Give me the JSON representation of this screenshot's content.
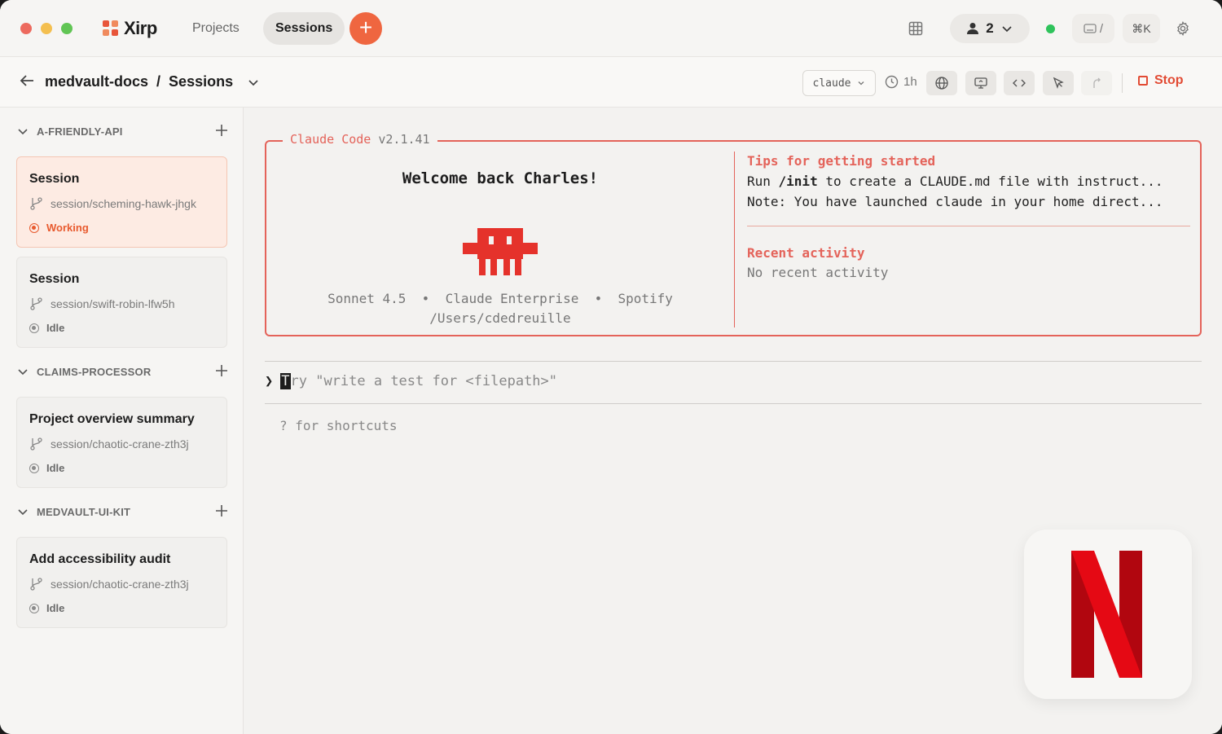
{
  "app": {
    "brand": "Xirp"
  },
  "topbar": {
    "nav_projects": "Projects",
    "nav_sessions": "Sessions",
    "add_label": "+",
    "users_count": "2",
    "kbd_shortcut": "/",
    "cmd_shortcut": "⌘K",
    "status_color": "#2fc35b"
  },
  "subheader": {
    "project": "medvault-docs",
    "separator": "/",
    "section": "Sessions",
    "model": "claude",
    "duration": "1h",
    "stop_label": "Stop"
  },
  "sidebar": {
    "groups": [
      {
        "name": "A-FRIENDLY-API",
        "sessions": [
          {
            "title": "Session",
            "branch": "session/scheming-hawk-jhgk",
            "status": "Working",
            "active": true
          },
          {
            "title": "Session",
            "branch": "session/swift-robin-lfw5h",
            "status": "Idle",
            "active": false
          }
        ]
      },
      {
        "name": "CLAIMS-PROCESSOR",
        "sessions": [
          {
            "title": "Project overview summary",
            "branch": "session/chaotic-crane-zth3j",
            "status": "Idle",
            "active": false
          }
        ]
      },
      {
        "name": "MEDVAULT-UI-KIT",
        "sessions": [
          {
            "title": "Add accessibility audit",
            "branch": "session/chaotic-crane-zth3j",
            "status": "Idle",
            "active": false
          }
        ]
      }
    ]
  },
  "terminal": {
    "legend_name": "Claude Code",
    "legend_version": "v2.1.41",
    "welcome": "Welcome back Charles!",
    "meta": "Sonnet 4.5  •  Claude Enterprise  •  Spotify",
    "path": "/Users/cdedreuille",
    "tips_title": "Tips for getting started",
    "tip1_pre": "Run ",
    "tip1_cmd": "/init",
    "tip1_post": " to create a CLAUDE.md file with instruct...",
    "tip2": "Note: You have launched claude in your home direct...",
    "recent_title": "Recent activity",
    "recent_empty": "No recent activity",
    "prompt_symbol": "❯",
    "prompt_cursor_char": "T",
    "prompt_placeholder": "ry \"write a test for <filepath>\"",
    "shortcuts_hint": "? for shortcuts"
  },
  "colors": {
    "accent": "#ef6640",
    "terminal_accent": "#e4635a",
    "stop": "#e24b34",
    "mascot": "#e5322b",
    "netflix_red": "#e50914"
  },
  "app_tile": {
    "icon": "netflix-icon"
  }
}
